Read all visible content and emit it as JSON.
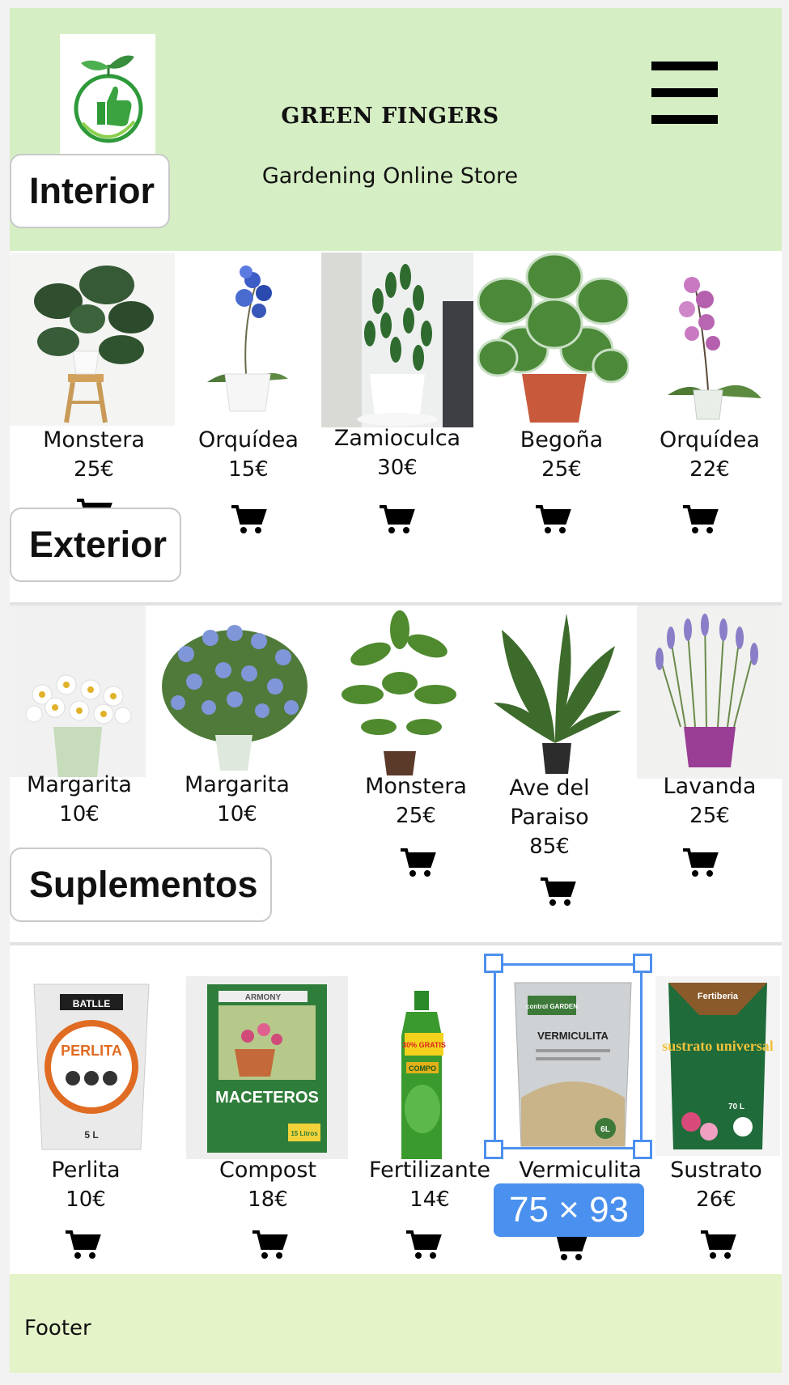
{
  "header": {
    "brand": "GREEN FINGERS",
    "tagline": "Gardening Online Store"
  },
  "sections": [
    {
      "label": "Interior",
      "products": [
        {
          "name": "Monstera",
          "price": "25€",
          "image": "monstera-plant"
        },
        {
          "name": "Orquídea",
          "price": "15€",
          "image": "blue-orchid"
        },
        {
          "name": "Zamioculca",
          "price": "30€",
          "image": "zamioculca-plant"
        },
        {
          "name": "Begoña",
          "price": "25€",
          "image": "begonia-plant"
        },
        {
          "name": "Orquídea",
          "price": "22€",
          "image": "pink-orchid"
        }
      ]
    },
    {
      "label": "Exterior",
      "products": [
        {
          "name": "Margarita",
          "price": "10€",
          "image": "white-daisies"
        },
        {
          "name": "Margarita",
          "price": "10€",
          "image": "blue-daisies"
        },
        {
          "name": "Monstera",
          "price": "25€",
          "image": "schefflera-plant"
        },
        {
          "name": "Ave del Paraiso",
          "price": "85€",
          "image": "bird-of-paradise"
        },
        {
          "name": "Lavanda",
          "price": "25€",
          "image": "lavender-pot"
        }
      ]
    },
    {
      "label": "Suplementos",
      "products": [
        {
          "name": "Perlita",
          "price": "10€",
          "image": "perlite-bag"
        },
        {
          "name": "Compost",
          "price": "18€",
          "image": "compost-bag"
        },
        {
          "name": "Fertilizante",
          "price": "14€",
          "image": "fertilizer-bottle"
        },
        {
          "name": "Vermiculita",
          "price": "",
          "image": "vermiculite-bag"
        },
        {
          "name": "Sustrato",
          "price": "26€",
          "image": "substrate-bag"
        }
      ]
    }
  ],
  "product_images": {
    "perlite": {
      "brand": "BATLLE",
      "title": "PERLITA",
      "size": "5 L"
    },
    "compost": {
      "brand": "ARMONY",
      "title": "MACETEROS",
      "size": "15 Litros"
    },
    "fertilizer": {
      "brand": "COMPO",
      "promo": "30% GRATIS"
    },
    "vermiculite": {
      "brand": "control GARDEN",
      "title": "VERMICULITA",
      "size": "6L"
    },
    "substrate": {
      "brand": "Fertiberia",
      "title": "sustrato universal",
      "size": "70 L"
    }
  },
  "footer": {
    "text": "Footer"
  },
  "overlay": {
    "size_badge": "75 × 93"
  },
  "colors": {
    "header_bg": "#d6eec4",
    "footer_bg": "#e4f3c8",
    "selection": "#4a90ee"
  }
}
